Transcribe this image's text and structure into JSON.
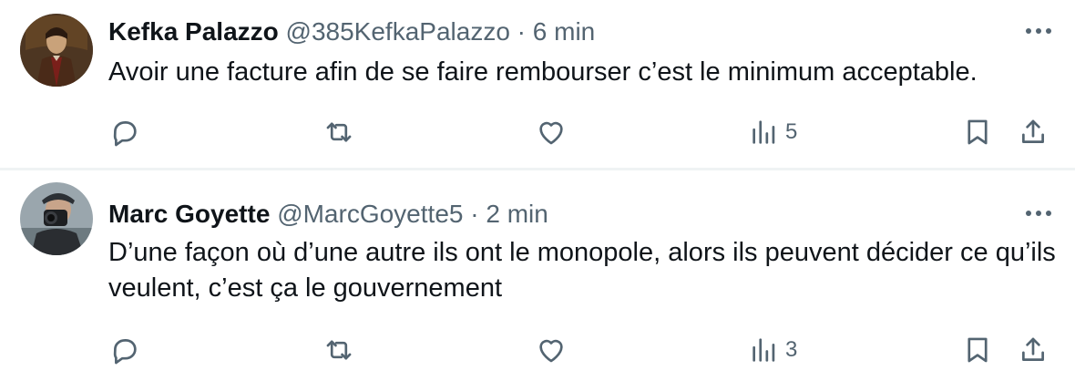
{
  "tweets": [
    {
      "name": "Kefka Palazzo",
      "handle": "@385KefkaPalazzo",
      "separator": "·",
      "time": "6 min",
      "text": "Avoir une facture afin de se faire rembourser c’est le minimum acceptable.",
      "views": "5"
    },
    {
      "name": "Marc Goyette",
      "handle": "@MarcGoyette5",
      "separator": "·",
      "time": "2 min",
      "text": "D’une façon où d’une autre ils ont le monopole, alors ils peuvent décider ce qu’ils veulent, c’est ça le gouvernement",
      "views": "3"
    }
  ],
  "icons": {
    "more": "more-horizontal-icon",
    "reply": "reply-icon",
    "retweet": "retweet-icon",
    "like": "heart-icon",
    "views": "views-bar-chart-icon",
    "bookmark": "bookmark-icon",
    "share": "share-icon"
  },
  "colors": {
    "text": "#0f1419",
    "secondary": "#536471",
    "divider": "#eff3f4"
  }
}
